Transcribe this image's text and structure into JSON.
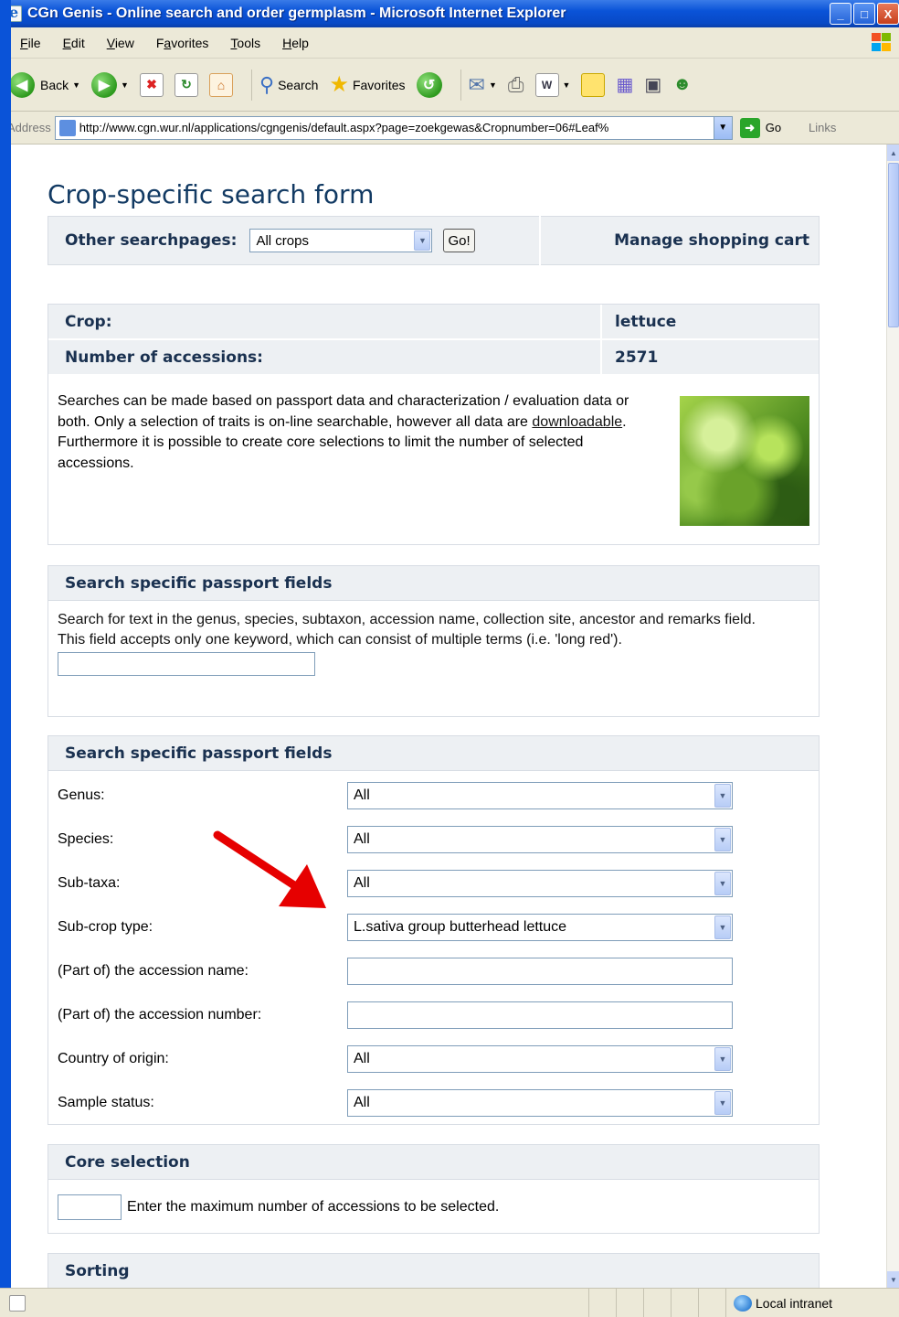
{
  "window": {
    "title": "CGn Genis - Online search and order germplasm - Microsoft Internet Explorer",
    "buttons": [
      "_",
      "□",
      "X"
    ]
  },
  "menu": {
    "items": [
      {
        "pre": "",
        "u": "F",
        "post": "ile"
      },
      {
        "pre": "",
        "u": "E",
        "post": "dit"
      },
      {
        "pre": "",
        "u": "V",
        "post": "iew"
      },
      {
        "pre": "F",
        "u": "a",
        "post": "vorites"
      },
      {
        "pre": "",
        "u": "T",
        "post": "ools"
      },
      {
        "pre": "",
        "u": "H",
        "post": "elp"
      }
    ]
  },
  "toolbar": {
    "back_label": "Back",
    "search_label": "Search",
    "favorites_label": "Favorites"
  },
  "address": {
    "label": "Address",
    "url": "http://www.cgn.wur.nl/applications/cgngenis/default.aspx?page=zoekgewas&Cropnumber=06#Leaf%",
    "go_label": "Go",
    "links_label": "Links"
  },
  "page": {
    "title": "Crop-specific search form",
    "other_searchpages_label": "Other searchpages:",
    "other_searchpages_value": "All crops",
    "go_button": "Go!",
    "cart_link": "Manage shopping cart",
    "crop_label": "Crop:",
    "crop_value": "lettuce",
    "accessions_label": "Number of accessions:",
    "accessions_value": "2571",
    "desc_part1": "Searches can be made based on passport data and characterization / evaluation data or both. Only a selection of traits is on-line searchable, however all data are ",
    "desc_link": "downloadable",
    "desc_part2": ".",
    "desc_line2": "Furthermore it is possible to create core selections to limit the number of selected accessions.",
    "panel1": {
      "heading": "Search specific passport fields",
      "text1": "Search for text in the genus, species, subtaxon, accession name, collection site, ancestor and remarks field.",
      "text2": "This field accepts only one keyword, which can consist of multiple terms (i.e. 'long red').",
      "input_value": ""
    },
    "panel2": {
      "heading": "Search specific passport fields",
      "rows": [
        {
          "label": "Genus:",
          "value": "All"
        },
        {
          "label": "Species:",
          "value": "All"
        },
        {
          "label": "Sub-taxa:",
          "value": "All"
        },
        {
          "label": "Sub-crop type:",
          "value": "L.sativa group butterhead lettuce"
        },
        {
          "label": "(Part of) the accession name:",
          "value": ""
        },
        {
          "label": "(Part of) the accession number:",
          "value": ""
        },
        {
          "label": "Country of origin:",
          "value": "All"
        },
        {
          "label": "Sample status:",
          "value": "All"
        }
      ]
    },
    "panel3": {
      "heading": "Core selection",
      "text": "Enter the maximum number of accessions to be selected.",
      "input_value": ""
    },
    "panel4": {
      "heading": "Sorting"
    }
  },
  "status": {
    "zone": "Local intranet"
  },
  "colors": {
    "title_blue": "#123a63",
    "panel_head_bg": "#edf0f3",
    "arrow_red": "#e60000"
  }
}
